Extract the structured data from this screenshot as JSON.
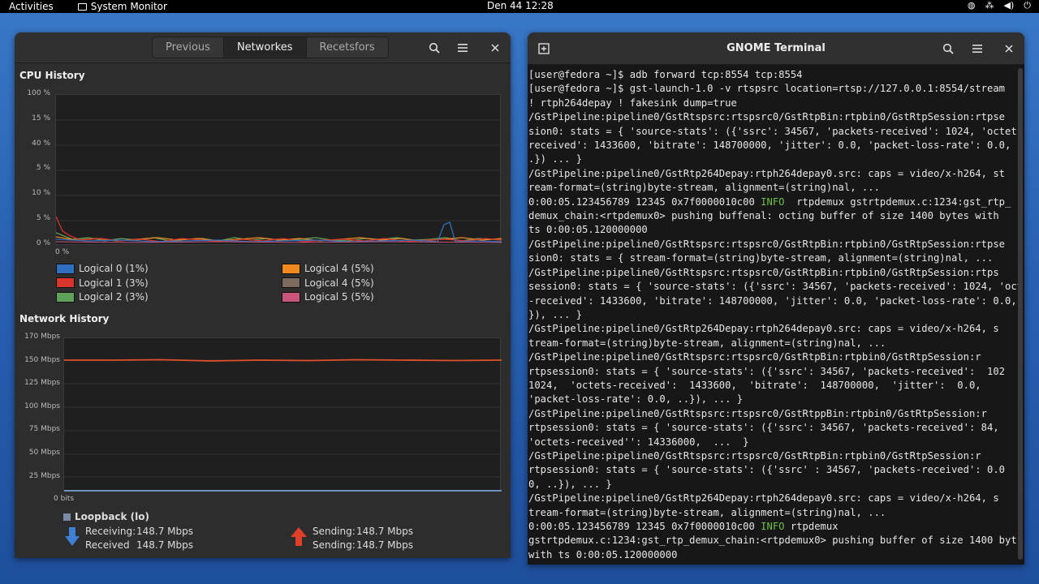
{
  "topbar": {
    "activities": "Activities",
    "app_name": "System Monitor",
    "clock": "Den 44  12:28"
  },
  "sysmon": {
    "tabs": [
      {
        "label": "Previous",
        "active": false
      },
      {
        "label": "Networkes",
        "active": true
      },
      {
        "label": "Recetsfors",
        "active": false
      }
    ],
    "cpu_title": "CPU History",
    "cpu_yticks": [
      "100 %",
      "15 %",
      "40 %",
      "5 %",
      "10 %",
      "5 %",
      "0 %"
    ],
    "cpu_x_label": "0 %",
    "cpu_legend": [
      {
        "label": "Logical 0 (1%)",
        "color": "#2f6fbf"
      },
      {
        "label": "Logical 1 (3%)",
        "color": "#d9342b"
      },
      {
        "label": "Logical 2 (3%)",
        "color": "#5fa25a"
      },
      {
        "label": "Logical 4 (5%)",
        "color": "#f08a1c"
      },
      {
        "label": "Logical 4 (5%)",
        "color": "#7c6a5e"
      },
      {
        "label": "Logical 5 (5%)",
        "color": "#c9557c"
      }
    ],
    "net_title": "Network History",
    "net_yticks": [
      "170 Mbps",
      "150 Mbps",
      "125 Mbps",
      "100 Mbps",
      "75 Mbps",
      "50 Mbps",
      "25 Mbps"
    ],
    "net_x_label": "0 bits",
    "loopback": "Loopback (lo)",
    "receiving_label": "Receiving:",
    "receiving_value": "148.7 Mbps",
    "received_label": "Received",
    "received_value": "148.7 Mbps",
    "sending_label": "Sending:",
    "sending_value": "148.7 Mbps",
    "sending2_label": "Sending:",
    "sending2_value": "148.7 Mbps",
    "colors": {
      "receive": "#3f7fd4",
      "send": "#e0402a",
      "net_line": "#e0502a"
    }
  },
  "terminal": {
    "title": "GNOME Terminal",
    "lines": [
      "[user@fedora ~]$ adb forward tcp:8554 tcp:8554",
      "[user@fedora ~]$ gst-launch-1.0 -v rtspsrc location=rtsp://127.0.0.1:8554/stream",
      "! rtph264depay ! fakesink dump=true",
      "/GstPipeline:pipeline0/GstRtspsrc:rtspsrc0/GstRtpBin:rtpbin0/GstRtpSession:rtpse",
      "sion0: stats = { 'source-stats': ({'ssrc': 34567, 'packets-received': 1024, 'octets-",
      "received': 1433600, 'bitrate': 148700000, 'jitter': 0.0, 'packet-loss-rate': 0.0,",
      ".}) ... }",
      "/GstPipeline:pipeline0/GstRtp264Depay:rtph264depay0.src: caps = video/x-h264, st",
      "ream-format=(string)byte-stream, alignment=(string)nal, ...",
      "0:00:05.123456789 12345 0x7f0000010c00 INFO  rtpdemux gstrtpdemux.c:1234:gst_rtp_",
      "demux_chain:<rtpdemux0> pushing buffenal: octing buffer of size 1400 bytes with",
      "ts 0:00:05.120000000",
      "/GstPipeline:pipeline0/GstRtspsrc:rtspsrc0/GstRtpBin:rtpbin0/GstRtpSession:rtpse",
      "sion0: stats = { stream-format=(string)byte-stream, alignment=(string)nal, ...",
      "/GstPipeline:pipeline0/GstRtspsrc:rtspsrc0/GstRtpBin:rtpbin0/GstRtpSession:rtps",
      "session0: stats = { 'source-stats': ({'ssrc': 34567, 'packets-received': 1024, 'octet",
      "-received': 1433600, 'bitrate': 148700000, 'jitter': 0.0, 'packet-loss-rate': 0.0, .",
      "}), ... }",
      "/GstPipeline:pipeline0/GstRtp264Depay:rtph264depay0.src: caps = video/x-h264, s",
      "tream-format=(string)byte-stream, alignment=(string)nal, ...",
      "/GstPipeline:pipeline0/GstRtspsrc:rtspsrc0/GstRtpBin:rtpbin0/GstRtpSession:r",
      "rtpsession0: stats = { 'source-stats': ({'ssrc': 34567, 'packets-received':  102",
      "1024,  'octets-received':  1433600,  'bitrate':  148700000,  'jitter':  0.0,",
      "'packet-loss-rate': 0.0, ..}), ... }",
      "/GstPipeline:pipeline0/GstRtspsrc:rtspsrc0/GstRtppBin:rtpbin0/GstRtpSession:r",
      "rtpsession0: stats = { 'source-stats': ({'ssrc': 34567, 'packets-received': 84,",
      "'octets-received'': 14336000,  ...  }",
      "/GstPipeline:pipeline0/GstRtspsrc:rtspsrc0/GstRtpBin:rtpbin0/GstRtpSession:r",
      "rtpsession0: stats = { 'source-stats': ({'ssrc' : 34567, 'packets-received': 0.0",
      "0, ..}), ... }",
      "/GstPipeline:pipeline0/GstRtp264Depay:rtph264depay0.src: caps = video/x-h264, s",
      "tream-format=(string)byte-stream, alignment=(string)nal, ...",
      "0:00:05.123456789 12345 0x7f0000010c00 INFO rtpdemux",
      "gstrtpdemux.c:1234:gst_rtp_demux_chain:<rtpdemux0> pushing buffer of size 1400 byt",
      "with ts 0:00:05.120000000"
    ]
  }
}
